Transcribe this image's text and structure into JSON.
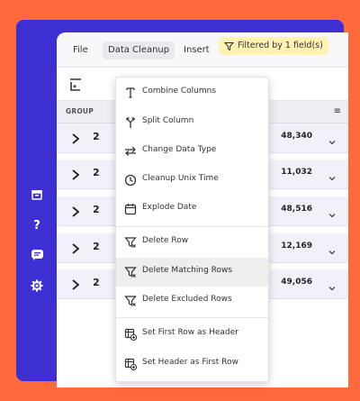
{
  "menubar": {
    "file": "File",
    "data_cleanup": "Data Cleanup",
    "insert": "Insert",
    "filter_badge": "Filtered by 1 field(s)"
  },
  "table": {
    "group_header": "GROUP",
    "rows": [
      {
        "num": "2",
        "value": "48,340"
      },
      {
        "num": "2",
        "value": "11,032"
      },
      {
        "num": "2",
        "value": "48,516"
      },
      {
        "num": "2",
        "value": "12,169"
      },
      {
        "num": "2",
        "value": "49,056"
      }
    ]
  },
  "dropdown": {
    "items": [
      {
        "label": "Combine Columns",
        "icon": "combine-columns-icon"
      },
      {
        "label": "Split Column",
        "icon": "split-column-icon"
      },
      {
        "label": "Change Data Type",
        "icon": "change-data-type-icon"
      },
      {
        "label": "Cleanup Unix Time",
        "icon": "clock-icon"
      },
      {
        "label": "Explode Date",
        "icon": "calendar-icon"
      },
      {
        "label": "Delete Row",
        "icon": "filter-delete-icon"
      },
      {
        "label": "Delete Matching Rows",
        "icon": "filter-delete-icon"
      },
      {
        "label": "Delete Excluded Rows",
        "icon": "filter-delete-icon"
      },
      {
        "label": "Set First Row as Header",
        "icon": "table-header-icon"
      },
      {
        "label": "Set Header as First Row",
        "icon": "table-header-icon"
      }
    ],
    "highlighted_index": 6
  },
  "colors": {
    "background": "#FF6A3D",
    "frame": "#3D2FD1",
    "filter_badge": "#FFF2B2",
    "row_bg": "#F2F1FA"
  }
}
